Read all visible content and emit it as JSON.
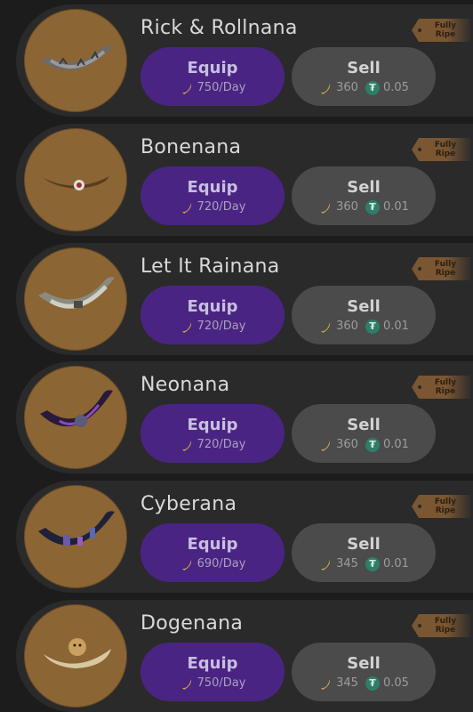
{
  "colors": {
    "equip": "#4a2482",
    "sell": "#4b4b4b",
    "avatar": "#8c6534",
    "tag": "#7a5632",
    "tether": "#2f7d68"
  },
  "icons": {
    "rate": "banana-icon",
    "price_banana": "banana-icon",
    "price_token": "tether-icon"
  },
  "items": [
    {
      "name": "Rick & Rollnana",
      "tag": "Fully Ripe",
      "equip_label": "Equip",
      "rate": "750/Day",
      "sell_label": "Sell",
      "price_banana": "360",
      "price_token": "0.05"
    },
    {
      "name": "Bonenana",
      "tag": "Fully Ripe",
      "equip_label": "Equip",
      "rate": "720/Day",
      "sell_label": "Sell",
      "price_banana": "360",
      "price_token": "0.01"
    },
    {
      "name": "Let It Rainana",
      "tag": "Fully Ripe",
      "equip_label": "Equip",
      "rate": "720/Day",
      "sell_label": "Sell",
      "price_banana": "360",
      "price_token": "0.01"
    },
    {
      "name": "Neonana",
      "tag": "Fully Ripe",
      "equip_label": "Equip",
      "rate": "720/Day",
      "sell_label": "Sell",
      "price_banana": "360",
      "price_token": "0.01"
    },
    {
      "name": "Cyberana",
      "tag": "Fully Ripe",
      "equip_label": "Equip",
      "rate": "690/Day",
      "sell_label": "Sell",
      "price_banana": "345",
      "price_token": "0.01"
    },
    {
      "name": "Dogenana",
      "tag": "Fully Ripe",
      "equip_label": "Equip",
      "rate": "750/Day",
      "sell_label": "Sell",
      "price_banana": "345",
      "price_token": "0.05"
    }
  ]
}
